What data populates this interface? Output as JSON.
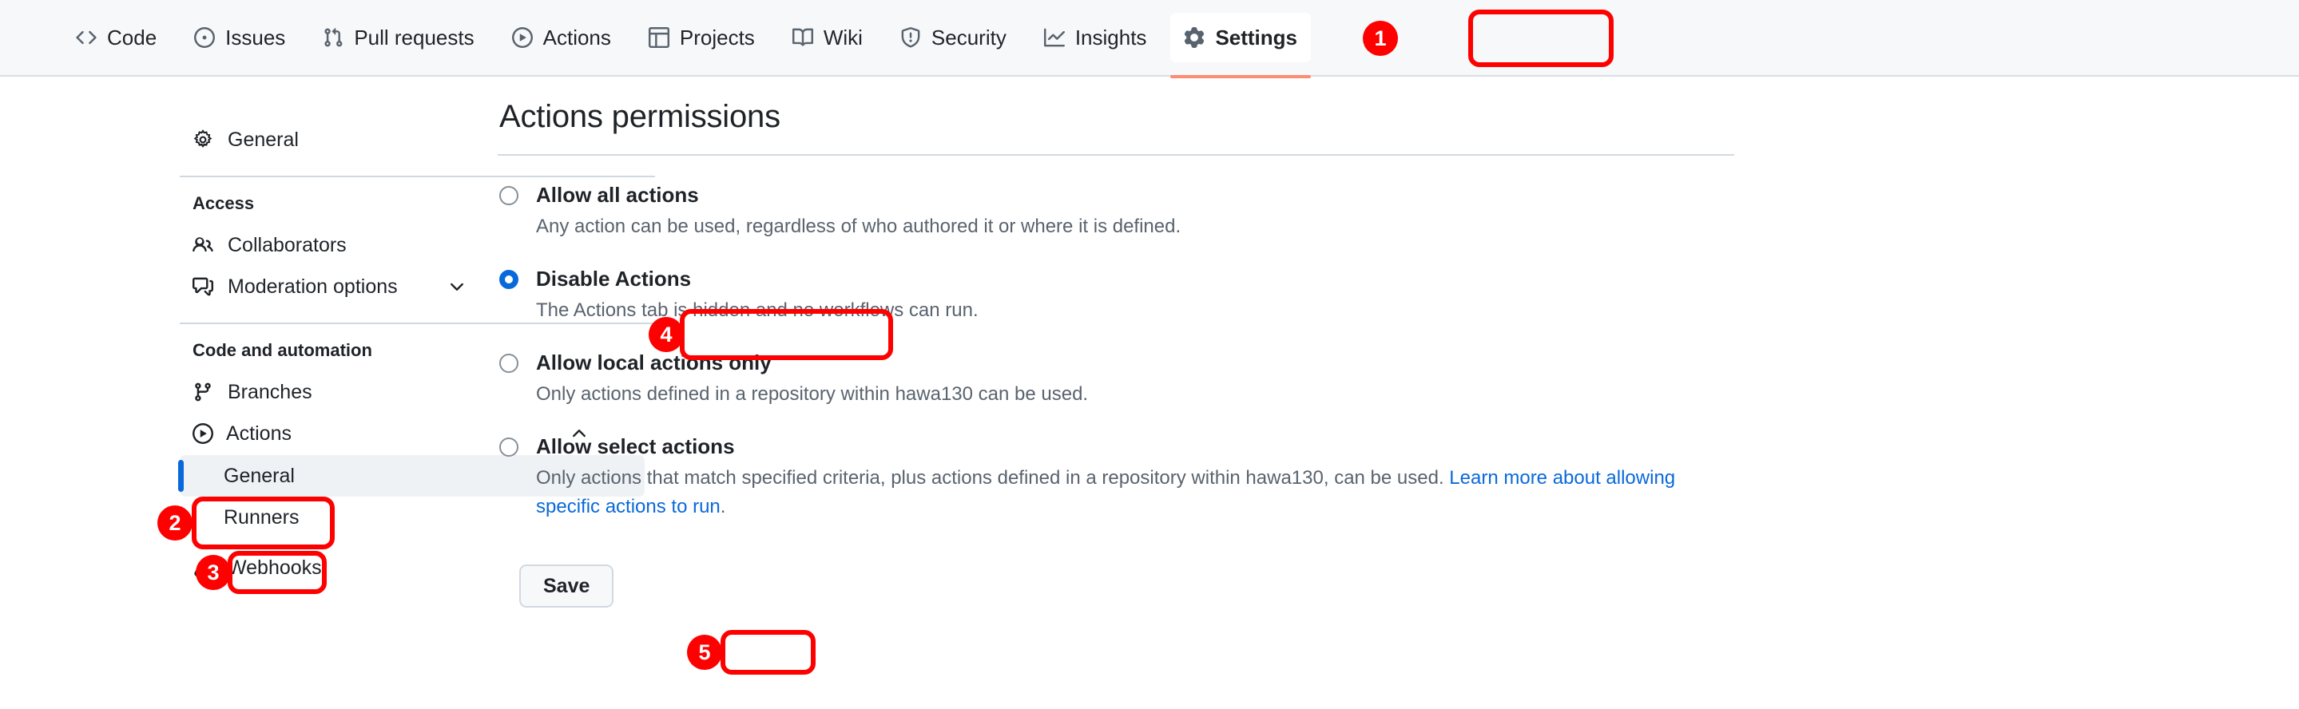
{
  "repo_nav": {
    "items": [
      {
        "label": "Code",
        "icon": "code-icon",
        "active": false
      },
      {
        "label": "Issues",
        "icon": "issue-icon",
        "active": false
      },
      {
        "label": "Pull requests",
        "icon": "git-pull-request-icon",
        "active": false
      },
      {
        "label": "Actions",
        "icon": "play-icon",
        "active": false
      },
      {
        "label": "Projects",
        "icon": "table-icon",
        "active": false
      },
      {
        "label": "Wiki",
        "icon": "book-icon",
        "active": false
      },
      {
        "label": "Security",
        "icon": "shield-icon",
        "active": false
      },
      {
        "label": "Insights",
        "icon": "graph-icon",
        "active": false
      },
      {
        "label": "Settings",
        "icon": "gear-icon",
        "active": true
      }
    ],
    "active_underline_color": "#fd8c73"
  },
  "sidebar": {
    "general": {
      "label": "General",
      "icon": "gear-icon"
    },
    "sections": [
      {
        "title": "Access",
        "items": [
          {
            "label": "Collaborators",
            "icon": "people-icon",
            "chevron": ""
          },
          {
            "label": "Moderation options",
            "icon": "comment-discussion-icon",
            "chevron": "chevron-down-icon"
          }
        ]
      },
      {
        "title": "Code and automation",
        "items": [
          {
            "label": "Branches",
            "icon": "git-branch-icon",
            "chevron": ""
          },
          {
            "label": "Actions",
            "icon": "play-icon",
            "chevron": "chevron-up-icon"
          }
        ]
      }
    ],
    "actions_sub_items": [
      {
        "label": "General",
        "selected": true
      },
      {
        "label": "Runners",
        "selected": false
      }
    ],
    "webhooks": {
      "label": "Webhooks",
      "icon": "webhook-icon"
    }
  },
  "content": {
    "title": "Actions permissions",
    "options": [
      {
        "label": "Allow all actions",
        "description": "Any action can be used, regardless of who authored it or where it is defined.",
        "checked": false,
        "link_text": "",
        "link_tail": ""
      },
      {
        "label": "Disable Actions",
        "description": "The Actions tab is hidden and no workflows can run.",
        "checked": true,
        "link_text": "",
        "link_tail": ""
      },
      {
        "label": "Allow local actions only",
        "description": "Only actions defined in a repository within hawa130 can be used.",
        "checked": false,
        "link_text": "",
        "link_tail": ""
      },
      {
        "label": "Allow select actions",
        "description": "Only actions that match specified criteria, plus actions defined in a repository within hawa130, can be used. ",
        "checked": false,
        "link_text": "Learn more about allowing specific actions to run",
        "link_tail": "."
      }
    ],
    "save_label": "Save"
  },
  "annotations": {
    "accent_color": "#ff0000",
    "markers": [
      {
        "number": "1",
        "target": "settings-tab"
      },
      {
        "number": "2",
        "target": "sidebar-actions"
      },
      {
        "number": "3",
        "target": "sidebar-actions-general"
      },
      {
        "number": "4",
        "target": "disable-actions-radio"
      },
      {
        "number": "5",
        "target": "save-button"
      }
    ]
  }
}
